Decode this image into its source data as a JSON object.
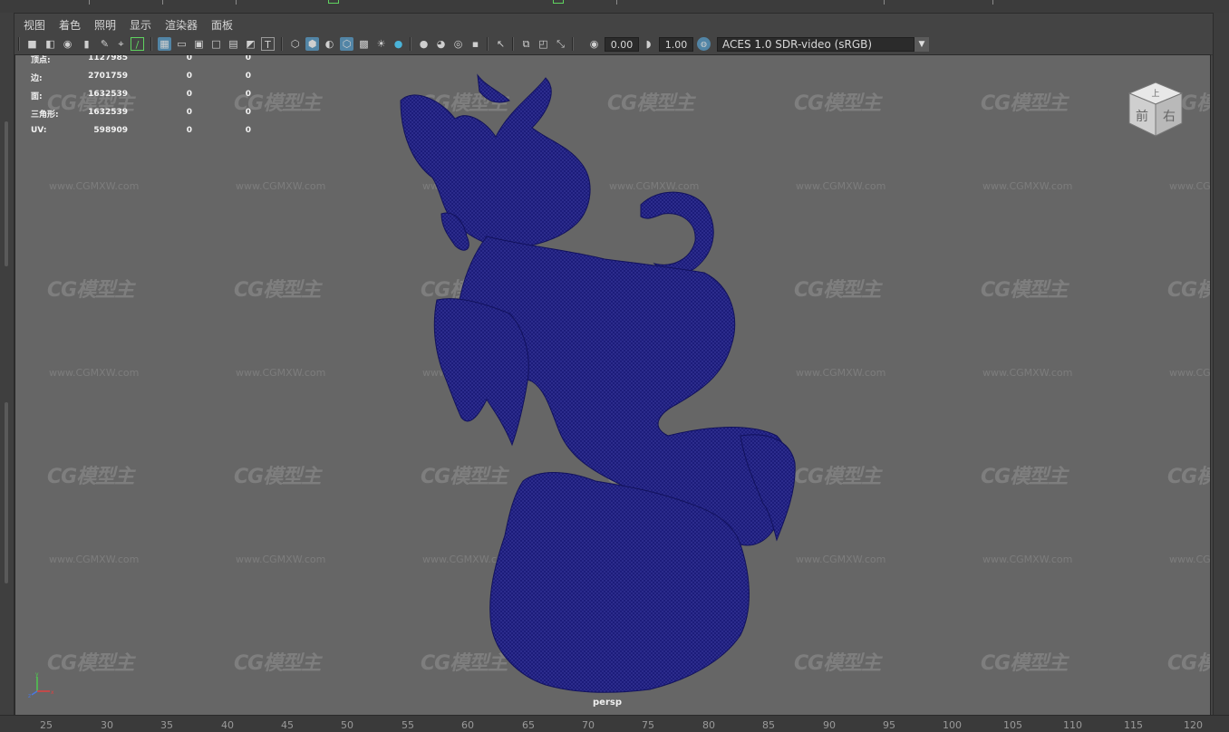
{
  "menu": {
    "items": [
      {
        "label": "视图"
      },
      {
        "label": "着色"
      },
      {
        "label": "照明"
      },
      {
        "label": "显示"
      },
      {
        "label": "渲染器"
      },
      {
        "label": "面板"
      }
    ]
  },
  "toolbar": {
    "exposure_value": "0.00",
    "gamma_value": "1.00",
    "color_space": "ACES 1.0 SDR-video (sRGB)"
  },
  "stats": {
    "rows": [
      {
        "label": "顶点:",
        "total": "1127985",
        "selected": "0",
        "extra": "0"
      },
      {
        "label": "边:",
        "total": "2701759",
        "selected": "0",
        "extra": "0"
      },
      {
        "label": "面:",
        "total": "1632539",
        "selected": "0",
        "extra": "0"
      },
      {
        "label": "三角形:",
        "total": "1632539",
        "selected": "0",
        "extra": "0"
      },
      {
        "label": "UV:",
        "total": "598909",
        "selected": "0",
        "extra": "0"
      }
    ]
  },
  "viewport": {
    "camera_label": "persp",
    "viewcube": {
      "face_front": "前",
      "face_right": "右",
      "face_top": "上"
    },
    "watermark_logo": "CG模型主",
    "watermark_url": "www.CGMXW.com",
    "mesh_color": "#1c1c7a"
  },
  "timeline": {
    "labels": [
      "25",
      "30",
      "35",
      "40",
      "45",
      "50",
      "55",
      "60",
      "65",
      "70",
      "75",
      "80",
      "85",
      "90",
      "95",
      "100",
      "105",
      "110",
      "115",
      "120"
    ]
  },
  "colors": {
    "viewport_bg": "#666666",
    "ui_bg": "#444444",
    "active_button": "#5285a6"
  }
}
